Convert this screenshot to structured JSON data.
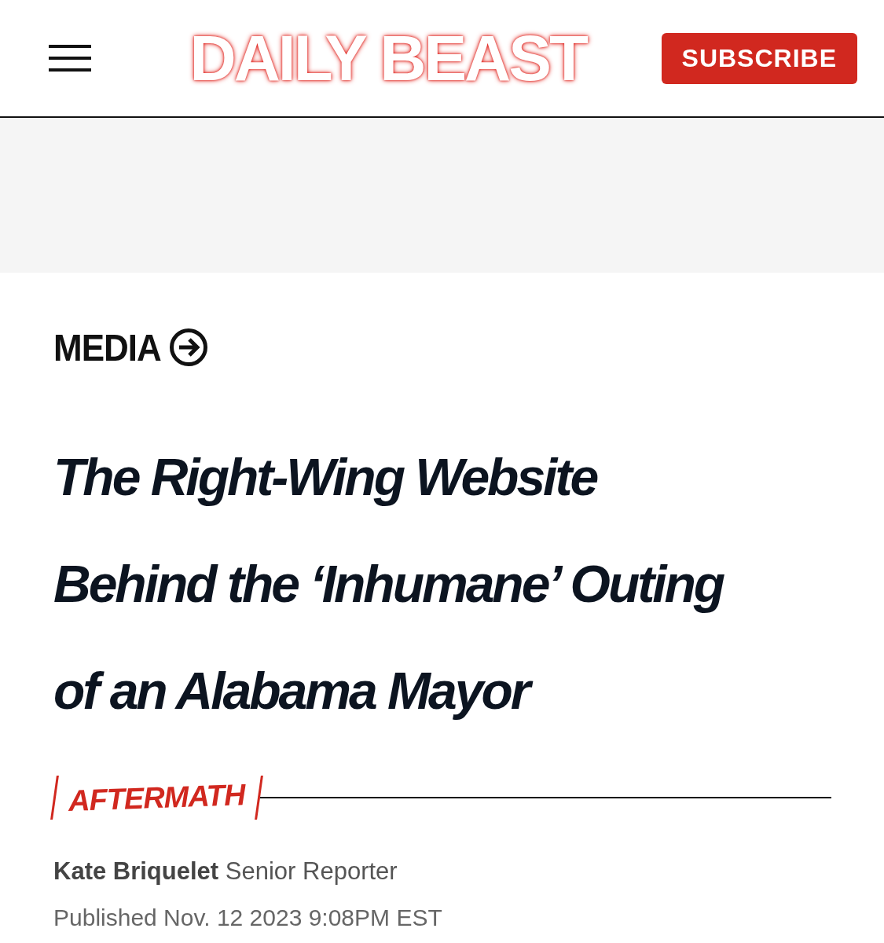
{
  "header": {
    "logo": "DAILY BEAST",
    "subscribe_button": "SUBSCRIBE"
  },
  "article": {
    "section": "MEDIA",
    "headline": "The Right-Wing Website Behind the ‘Inhumane’ Outing of an Alabama Mayor",
    "tag": "AFTERMATH",
    "author": "Kate Briquelet",
    "author_role": "Senior Reporter",
    "published": "Published Nov. 12 2023 9:08PM EST"
  }
}
